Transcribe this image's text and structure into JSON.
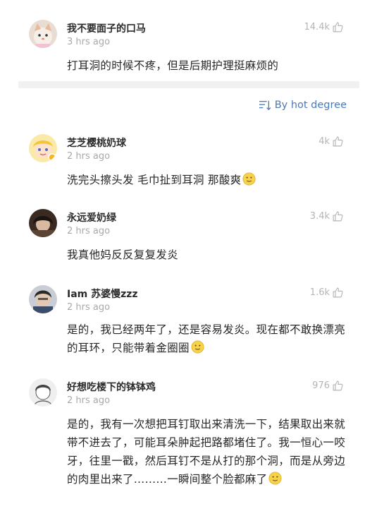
{
  "comments": [
    {
      "user": "我不要面子的口马",
      "time": "3 hrs ago",
      "likes": "14.4k",
      "text": "打耳洞的时候不疼，但是后期护理挺麻烦的",
      "avatar_icon": "cat-avatar"
    },
    {
      "user": "芝芝樱桃奶球",
      "time": "2 hrs ago",
      "likes": "4k",
      "text": "洗完头擦头发 毛巾扯到耳洞 那酸爽",
      "avatar_icon": "cartoon-avatar",
      "verified": true
    },
    {
      "user": "永远爱奶绿",
      "time": "2 hrs ago",
      "likes": "3.4k",
      "text": "我真他妈反反复复发炎",
      "avatar_icon": "person-avatar"
    },
    {
      "user": "Iam 苏婆慢zzz",
      "time": "2 hrs ago",
      "likes": "1.6k",
      "text": "是的，我已经两年了，还是容易发炎。现在都不敢换漂亮的耳环，只能带着金圈圈",
      "avatar_icon": "person-avatar"
    },
    {
      "user": "好想吃楼下的钵钵鸡",
      "time": "2 hrs ago",
      "likes": "976",
      "text": "是的，我有一次想把耳钉取出来清洗一下，结果取出来就带不进去了，可能耳朵肿起把路都堵住了。我一恒心一咬牙，往里一戳，然后耳钉不是从打的那个洞，而是从旁边的肉里出来了………一瞬间整个脸都麻了",
      "avatar_icon": "sketch-avatar"
    }
  ],
  "sort": {
    "label": "By hot degree",
    "icon": "sort-icon"
  },
  "colors": {
    "accent": "#4c79b8",
    "muted": "#a9a9a9",
    "divider": "#f1f1f1"
  }
}
